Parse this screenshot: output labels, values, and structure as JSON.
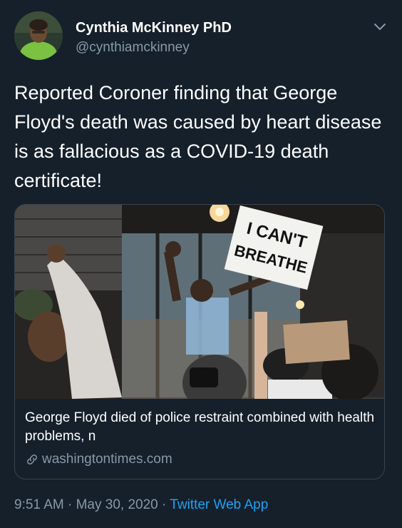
{
  "user": {
    "name": "Cynthia McKinney PhD",
    "handle": "@cynthiamckinney"
  },
  "tweet": {
    "text": "Reported Coroner finding that George Floyd's death was caused by heart disease is as fallacious as a COVID-19 death certificate!"
  },
  "card": {
    "sign_line1": "I CAN'T",
    "sign_line2": "BREATHE",
    "title": "George Floyd died of police restraint combined with health problems, n",
    "domain": "washingtontimes.com"
  },
  "footer": {
    "time": "9:51 AM",
    "separator": "·",
    "date": "May 30, 2020",
    "source": "Twitter Web App"
  },
  "colors": {
    "background": "#15202b",
    "text_primary": "#ffffff",
    "text_secondary": "#8899a6",
    "link": "#1da1f2",
    "border": "#38444d"
  },
  "icons": {
    "menu": "chevron-down-icon",
    "link": "link-icon"
  }
}
